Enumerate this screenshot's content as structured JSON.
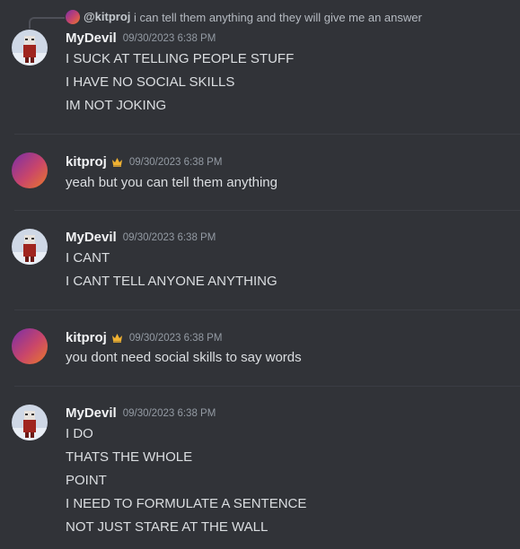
{
  "reply": {
    "name": "@kitproj",
    "text": "i can tell them anything and they will give me an answer"
  },
  "messages": [
    {
      "username": "MyDevil",
      "timestamp": "09/30/2023 6:38 PM",
      "avatar": "robot-avatar",
      "lines": [
        "I SUCK AT TELLING PEOPLE STUFF",
        "I HAVE NO SOCIAL SKILLS",
        "IM NOT JOKING"
      ]
    },
    {
      "username": "kitproj",
      "timestamp": "09/30/2023 6:38 PM",
      "avatar": "gradient-avatar",
      "badge": "crown-icon",
      "lines": [
        "yeah but you can tell them anything"
      ]
    },
    {
      "username": "MyDevil",
      "timestamp": "09/30/2023 6:38 PM",
      "avatar": "robot-avatar",
      "lines": [
        "I CANT",
        "I CANT TELL ANYONE ANYTHING"
      ]
    },
    {
      "username": "kitproj",
      "timestamp": "09/30/2023 6:38 PM",
      "avatar": "gradient-avatar",
      "badge": "crown-icon",
      "lines": [
        "you dont need social skills to say words"
      ]
    },
    {
      "username": "MyDevil",
      "timestamp": "09/30/2023 6:38 PM",
      "avatar": "robot-avatar",
      "lines": [
        "I DO",
        "THATS THE WHOLE",
        "POINT",
        "I NEED TO FORMULATE A SENTENCE",
        "NOT JUST STARE AT THE WALL"
      ]
    }
  ],
  "colors": {
    "background": "#313338",
    "username": "#f2f3f5",
    "text": "#dbdee1",
    "timestamp": "#949ba4",
    "crown": "#f0b232"
  }
}
